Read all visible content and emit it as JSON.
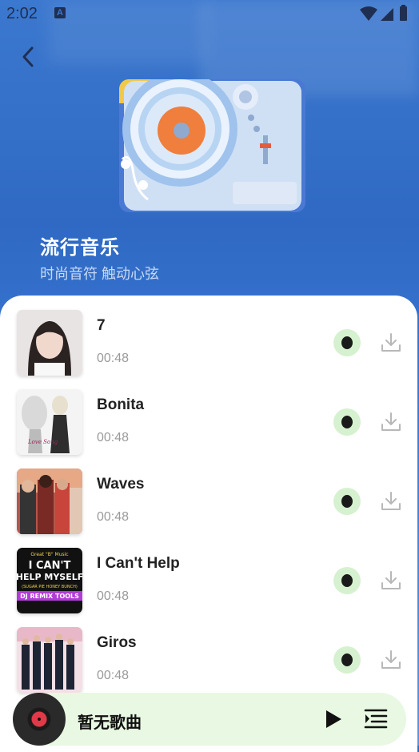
{
  "status_bar": {
    "time": "2:02",
    "notification_icon": "a-icon",
    "wifi_icon": "wifi-icon",
    "signal_icon": "signal-icon",
    "battery_icon": "battery-icon"
  },
  "header": {
    "back_icon": "back-arrow-icon",
    "playlist_title": "流行音乐",
    "playlist_subtitle": "时尚音符 触动心弦"
  },
  "songs": [
    {
      "name": "7",
      "duration": "00:48"
    },
    {
      "name": "Bonita",
      "duration": "00:48"
    },
    {
      "name": "Waves",
      "duration": "00:48"
    },
    {
      "name": "I Can't Help",
      "duration": "00:48"
    },
    {
      "name": "Giros",
      "duration": "00:48"
    }
  ],
  "player": {
    "now_playing": "暂无歌曲",
    "play_icon": "play-icon",
    "playlist_icon": "playlist-icon"
  },
  "colors": {
    "accent_green": "#d6f1cf",
    "player_bg": "#e8f8e2",
    "header_blue": "#3b78cf"
  }
}
